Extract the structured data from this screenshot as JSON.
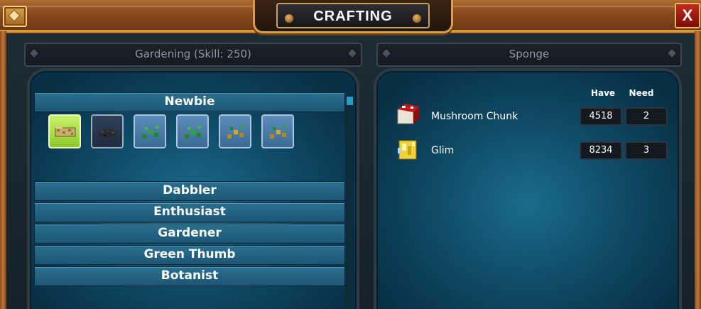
{
  "window": {
    "title": "CRAFTING",
    "close_label": "X"
  },
  "left_header": {
    "text": "Gardening (Skill: 250)"
  },
  "right_header": {
    "text": "Sponge"
  },
  "tiers": [
    {
      "label": "Newbie",
      "expanded": true
    },
    {
      "label": "Dabbler"
    },
    {
      "label": "Enthusiast"
    },
    {
      "label": "Gardener"
    },
    {
      "label": "Green Thumb"
    },
    {
      "label": "Botanist"
    }
  ],
  "recipes": [
    {
      "icon": "sponge-icon",
      "selected": true
    },
    {
      "icon": "dark-soil-icon"
    },
    {
      "icon": "green-sprout-icon"
    },
    {
      "icon": "green-sprout-icon"
    },
    {
      "icon": "yellow-sprout-icon"
    },
    {
      "icon": "yellow-sprout-icon"
    }
  ],
  "materials": {
    "have_label": "Have",
    "need_label": "Need",
    "items": [
      {
        "name": "Mushroom Chunk",
        "have": "4518",
        "need": "2",
        "icon": "mushroom-chunk-icon"
      },
      {
        "name": "Glim",
        "have": "8234",
        "need": "3",
        "icon": "glim-icon"
      }
    ]
  },
  "colors": {
    "wood": "#8a4a20",
    "gold_trim": "#d49a3a",
    "panel_blue": "#0f4a66",
    "tier_blue": "#2a6f8f",
    "selected_green": "#a6de44",
    "close_red": "#a01a10"
  }
}
